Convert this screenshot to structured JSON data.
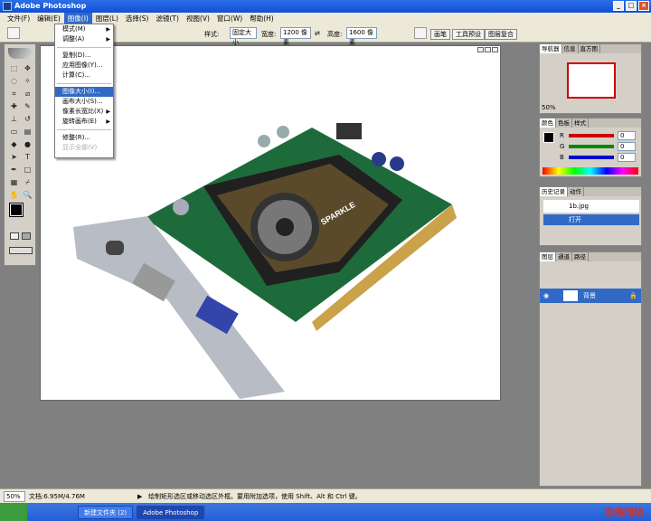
{
  "window": {
    "title": "Adobe Photoshop"
  },
  "menubar": [
    {
      "label": "文件(F)"
    },
    {
      "label": "编辑(E)"
    },
    {
      "label": "图像(I)"
    },
    {
      "label": "图层(L)"
    },
    {
      "label": "选择(S)"
    },
    {
      "label": "滤镜(T)"
    },
    {
      "label": "视图(V)"
    },
    {
      "label": "窗口(W)"
    },
    {
      "label": "帮助(H)"
    }
  ],
  "options": {
    "style_label": "样式:",
    "style_value": "固定大小",
    "width_label": "宽度:",
    "width_value": "1200 像素",
    "height_label": "高度:",
    "height_value": "1600 像素",
    "tabs": [
      "画笔",
      "工具预设",
      "图层复合"
    ]
  },
  "image_menu": {
    "items": [
      {
        "label": "模式(M)",
        "sub": true
      },
      {
        "label": "调整(A)",
        "sub": true
      },
      {
        "sep": true
      },
      {
        "label": "复制(D)..."
      },
      {
        "label": "应用图像(Y)..."
      },
      {
        "label": "计算(C)..."
      },
      {
        "sep": true
      },
      {
        "label": "图像大小(I)...",
        "highlight": true
      },
      {
        "label": "画布大小(S)..."
      },
      {
        "label": "像素长宽比(X)",
        "sub": true
      },
      {
        "label": "旋转画布(E)",
        "sub": true
      },
      {
        "sep": true
      },
      {
        "label": "修整(R)..."
      },
      {
        "label": "显示全部(V)",
        "disabled": true
      }
    ]
  },
  "navigator": {
    "tabs": [
      "导航器",
      "信息",
      "直方图"
    ],
    "zoom": "50%"
  },
  "color_panel": {
    "tabs": [
      "颜色",
      "色板",
      "样式"
    ],
    "channels": [
      {
        "name": "R",
        "value": "0",
        "color": "#cc0000"
      },
      {
        "name": "G",
        "value": "0",
        "color": "#008800"
      },
      {
        "name": "B",
        "value": "0",
        "color": "#0000cc"
      }
    ]
  },
  "history": {
    "tabs": [
      "历史记录",
      "动作"
    ],
    "snapshot": "1b.jpg",
    "state": "打开"
  },
  "layers": {
    "tabs": [
      "图层",
      "通道",
      "路径"
    ],
    "layer_name": "背景"
  },
  "status": {
    "zoom": "50%",
    "doc": "文档:6.95M/4.76M",
    "hint": "绘制矩形选区或移动选区外框。要用附加选项，使用 Shift、Alt 和 Ctrl 键。"
  },
  "taskbar": {
    "items": [
      "新建文件夹 (2)",
      "Adobe Photoshop"
    ]
  },
  "image_content": {
    "logo_text": "SPARKLE",
    "watermark": "思缘网络"
  }
}
